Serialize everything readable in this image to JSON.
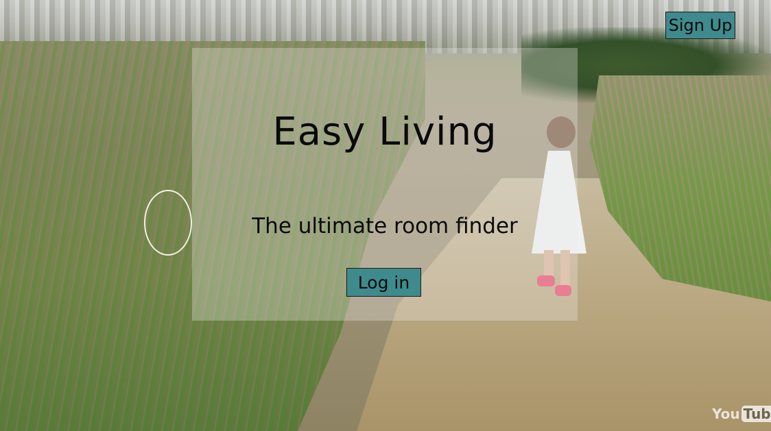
{
  "header": {
    "signup_label": "Sign Up"
  },
  "hero": {
    "title": "Easy Living",
    "tagline": "The ultimate room finder",
    "login_label": "Log in"
  },
  "watermark": {
    "you": "You",
    "tube": "Tube"
  },
  "colors": {
    "button_bg": "#3f8a8d",
    "panel_overlay": "rgba(235,232,230,.32)",
    "text": "#0a0a0a"
  }
}
